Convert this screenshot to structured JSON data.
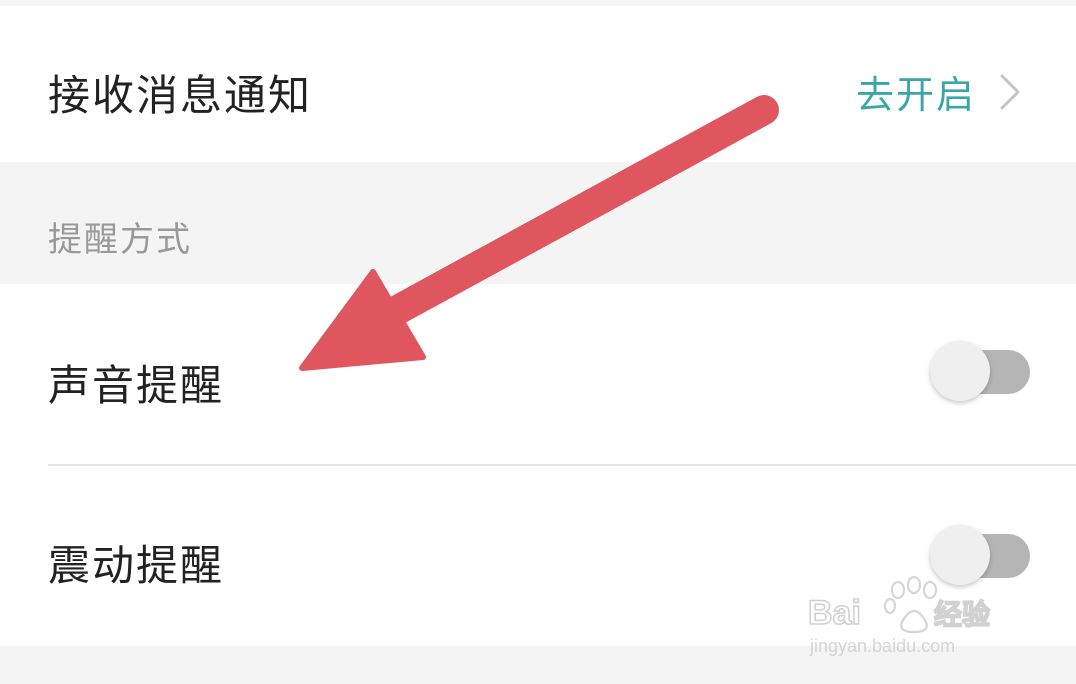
{
  "notifications": {
    "label": "接收消息通知",
    "action_text": "去开启",
    "action_icon": "chevron-right-icon"
  },
  "section": {
    "title": "提醒方式"
  },
  "settings": [
    {
      "label": "声音提醒",
      "enabled": false
    },
    {
      "label": "震动提醒",
      "enabled": false
    }
  ],
  "annotation": {
    "arrow_color": "#e0565e"
  },
  "watermark": {
    "brand_text": "Bai du 经验",
    "url_text": "jingyan.baidu.com"
  },
  "colors": {
    "accent": "#3aa7a5",
    "toggle_track_off": "#b5b5b5",
    "toggle_knob": "#efefef",
    "section_bg": "#f4f4f4"
  }
}
